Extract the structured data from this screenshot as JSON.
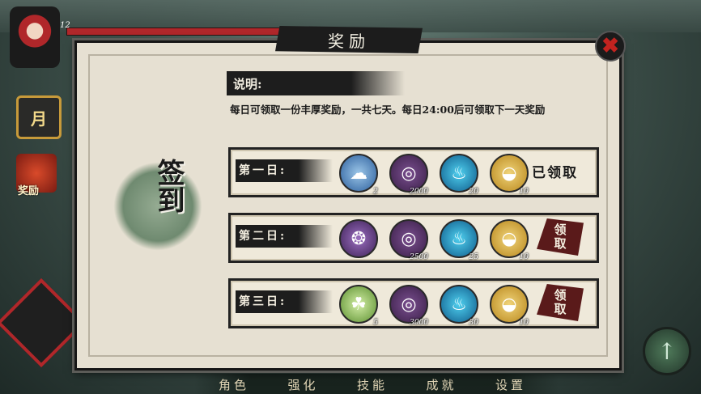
{
  "hud": {
    "level": "12"
  },
  "sidebar": {
    "month_icon_char": "月",
    "reward_label": "奖励"
  },
  "dialog": {
    "title": "奖励",
    "signin_title": "签到",
    "description_label": "说明:",
    "description_text": "每日可领取一份丰厚奖励，一共七天。每日24:00后可领取下一天奖励"
  },
  "days": [
    {
      "label": "第一日:",
      "items": [
        {
          "icon": "cloud-item-icon",
          "qty": "2"
        },
        {
          "icon": "coin-icon",
          "qty": "2000"
        },
        {
          "icon": "blue-flame-icon",
          "qty": "20"
        },
        {
          "icon": "gold-ingot-icon",
          "qty": "10"
        }
      ],
      "status": "已领取"
    },
    {
      "label": "第二日:",
      "items": [
        {
          "icon": "bird-item-icon",
          "qty": ""
        },
        {
          "icon": "coin-icon",
          "qty": "2500"
        },
        {
          "icon": "blue-flame-icon",
          "qty": "25"
        },
        {
          "icon": "gold-ingot-icon",
          "qty": "10"
        }
      ],
      "button": "领取"
    },
    {
      "label": "第三日:",
      "items": [
        {
          "icon": "herb-item-icon",
          "qty": "5"
        },
        {
          "icon": "coin-icon",
          "qty": "3000"
        },
        {
          "icon": "blue-flame-icon",
          "qty": "30"
        },
        {
          "icon": "gold-ingot-icon",
          "qty": "10"
        }
      ],
      "button": "领取"
    }
  ],
  "bottom_nav": [
    "角色",
    "强化",
    "技能",
    "成就",
    "设置"
  ],
  "colors": {
    "accent_red": "#b0272a",
    "panel_bg": "#e6e0d2",
    "ink": "#1c1c1c"
  }
}
